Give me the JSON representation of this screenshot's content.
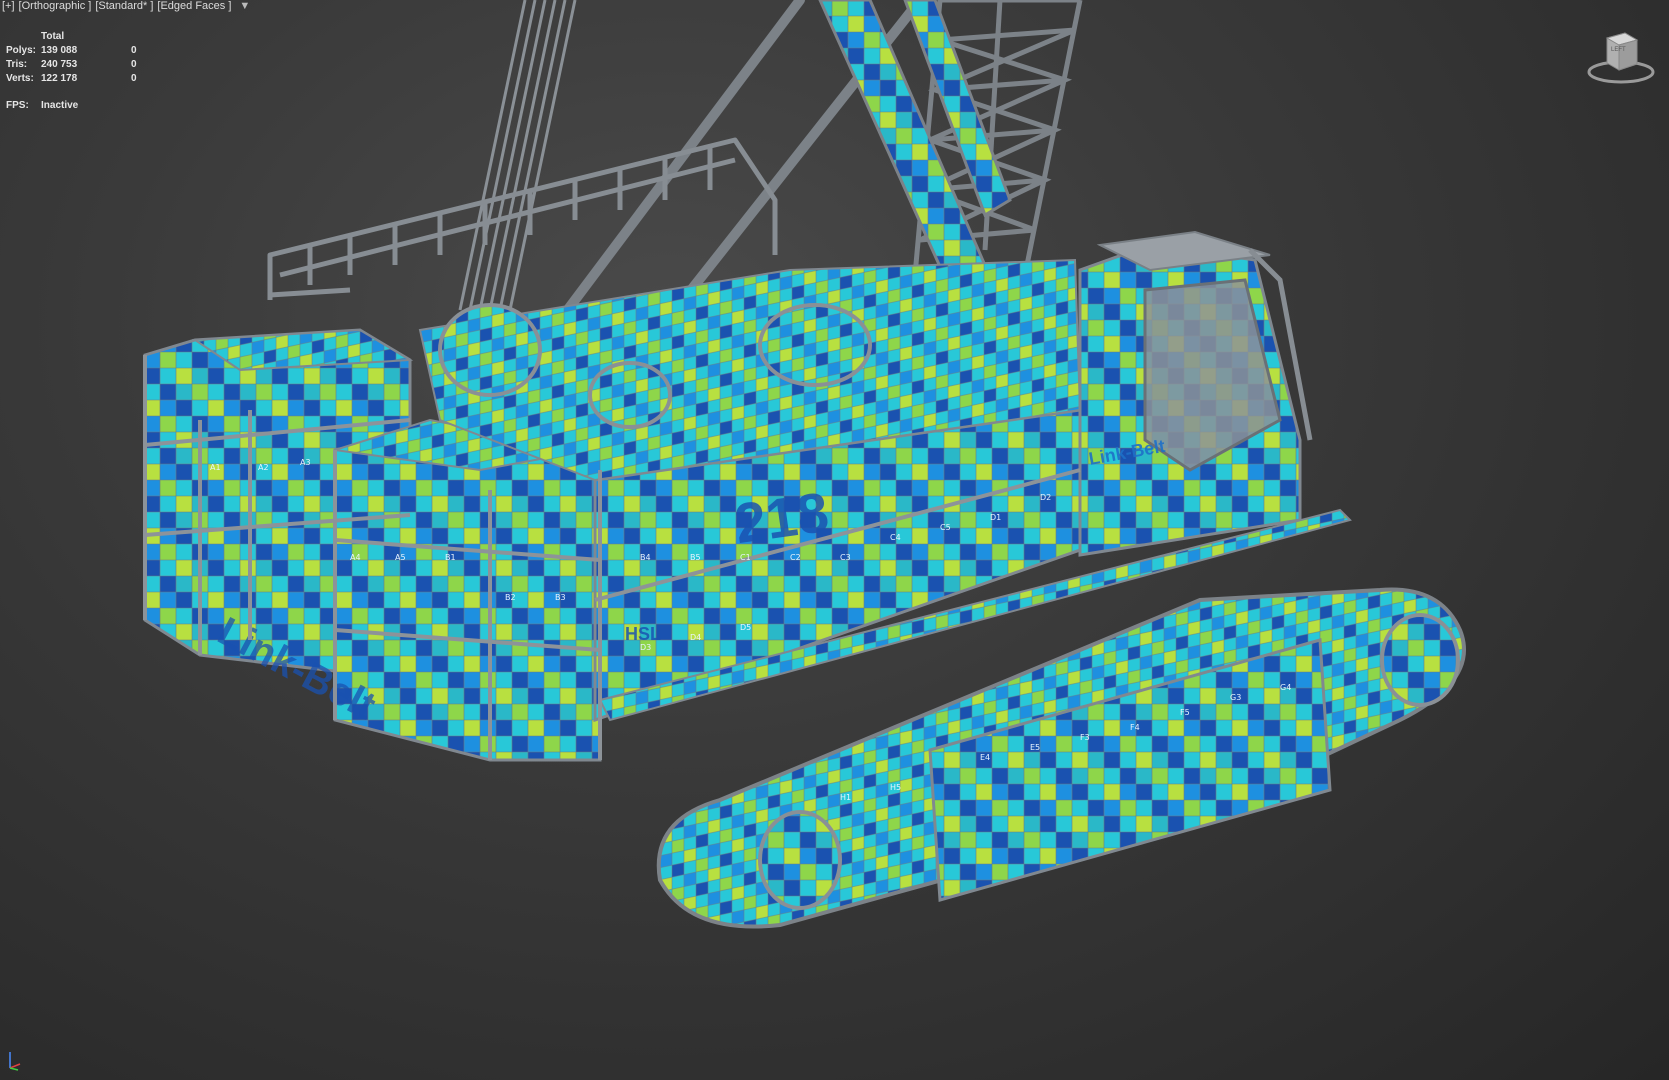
{
  "viewport_label": {
    "plus": "[+]",
    "view": "[Orthographic ]",
    "shading": "[Standard* ]",
    "style": "[Edged Faces ]",
    "filter_icon": "filter-icon"
  },
  "statistics": {
    "header": "Total",
    "rows": [
      {
        "label": "Polys:",
        "total": "139 088",
        "selected": "0"
      },
      {
        "label": "Tris:",
        "total": "240 753",
        "selected": "0"
      },
      {
        "label": "Verts:",
        "total": "122 178",
        "selected": "0"
      }
    ],
    "fps_label": "FPS:",
    "fps_value": "Inactive"
  },
  "model": {
    "decal_brand": "Link-Belt",
    "decal_model": "218",
    "decal_suffix": "HSL",
    "uv_checker_tiles": [
      "A1",
      "A2",
      "A3",
      "A4",
      "A5",
      "B1",
      "B2",
      "B3",
      "B4",
      "B5",
      "C1",
      "C2",
      "C3",
      "C4",
      "C5",
      "D1",
      "D2",
      "D3",
      "D4",
      "D5",
      "E4",
      "E5",
      "F3",
      "F4",
      "F5",
      "G3",
      "G4",
      "H1",
      "H5"
    ]
  },
  "viewcube": {
    "icon": "viewcube-icon",
    "face_label": "LEFT"
  },
  "axis_tripod": {
    "icon": "axis-tripod-icon"
  },
  "colors": {
    "background_center": "#4a4a4a",
    "background_edge": "#262626",
    "checker_blue_dark": "#1a52b0",
    "checker_blue": "#1e90e0",
    "checker_cyan": "#28c8d8",
    "checker_green": "#8ed64a",
    "checker_lime": "#b8e040",
    "railing_gray": "#808890",
    "overlay_text": "#e6e6e6"
  }
}
